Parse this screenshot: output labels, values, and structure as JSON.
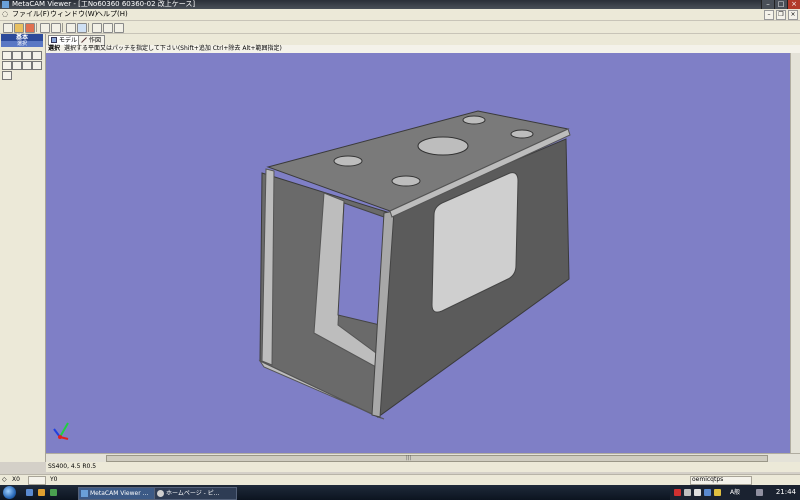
{
  "window": {
    "title": "MetaCAM Viewer - [工No60360 60360-02 改上ケース]"
  },
  "menu": {
    "items": [
      "ファイル(F)",
      "ウィンドウ(W)",
      "ヘルプ(H)"
    ]
  },
  "left_panel": {
    "header": "基本",
    "subheader": "選択"
  },
  "tabs": [
    {
      "label": "モデル",
      "icon": "model-icon",
      "active": true
    },
    {
      "label": "作図",
      "icon": "draw-icon",
      "active": false
    }
  ],
  "hint": {
    "mode_label": "選択",
    "text": "選択する平面又はパッチを指定して下さい(Shift+追加 Ctrl+除去 Alt+範囲指定)"
  },
  "viewport": {
    "background": "#7f7fc6"
  },
  "material": "SS400, 4.5 R0.5",
  "status": {
    "x_value": "X0",
    "y_value": "Y0",
    "right_text": "oemicqtps"
  },
  "taskbar": {
    "tasks": [
      {
        "label": "MetaCAM Viewer ..."
      },
      {
        "label": "ホームページ - ピ..."
      }
    ],
    "clock": "21:44",
    "lang": "A般"
  }
}
